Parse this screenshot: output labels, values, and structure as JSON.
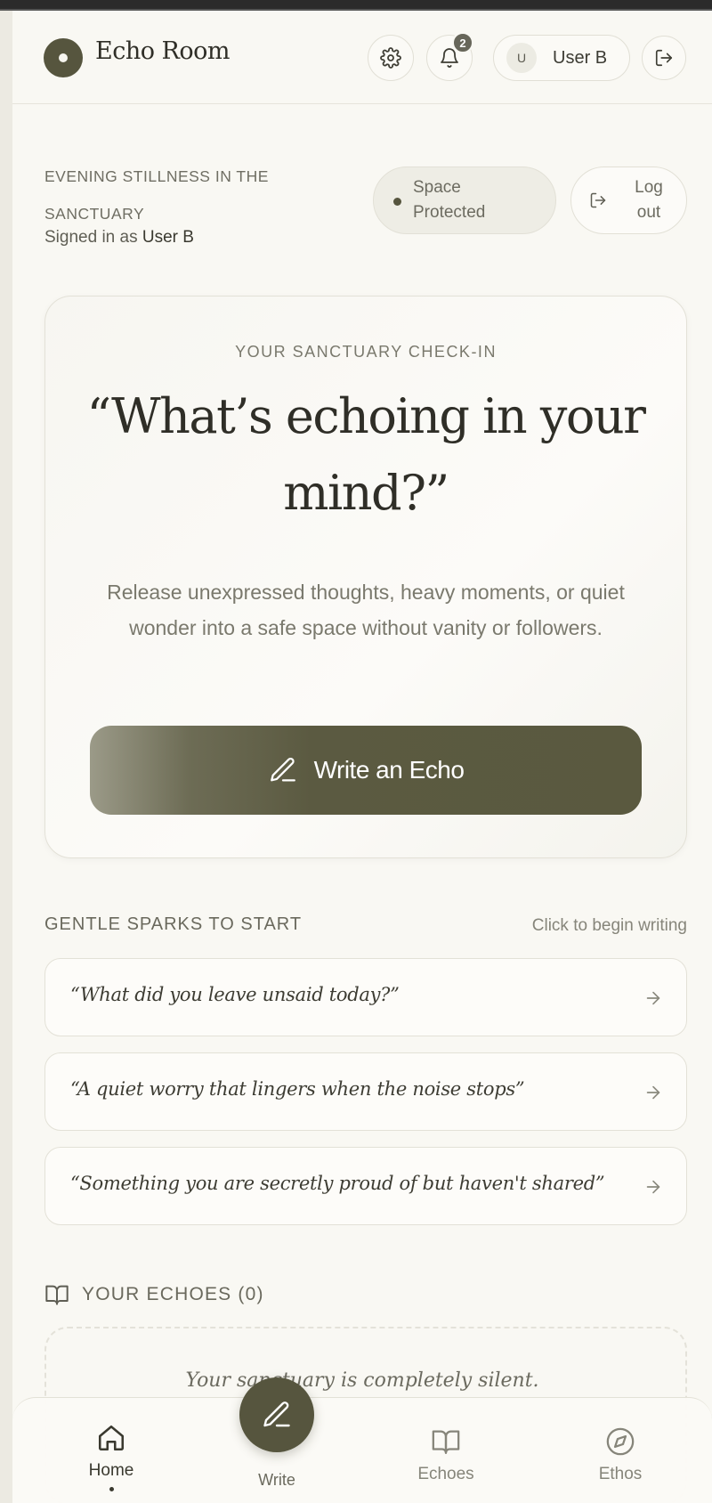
{
  "header": {
    "app_title": "Echo Room",
    "notification_count": "2",
    "user_initial": "U",
    "user_name": "User B",
    "icons": [
      "settings-icon",
      "bell-icon",
      "logout-icon"
    ]
  },
  "status": {
    "eyebrow": "EVENING STILLNESS IN THE SANCTUARY",
    "signed_in_prefix": "Signed in as ",
    "signed_in_user": "User B",
    "protected_label": "Space Protected",
    "logout_label": "Log out"
  },
  "checkin": {
    "eyebrow": "YOUR SANCTUARY CHECK-IN",
    "quote": "“What’s echoing in your mind?”",
    "description": "Release unexpressed thoughts, heavy moments, or quiet wonder into a safe space without vanity or followers.",
    "button_label": "Write an Echo"
  },
  "sparks": {
    "title": "GENTLE SPARKS TO START",
    "hint": "Click to begin writing",
    "items": [
      "“What did you leave unsaid today?”",
      "“A quiet worry that lingers when the noise stops”",
      "“Something you are secretly proud of but haven't shared”"
    ]
  },
  "echoes": {
    "title": "YOUR ECHOES (0)",
    "empty_text": "Your sanctuary is completely silent."
  },
  "nav": {
    "items": [
      {
        "label": "Home",
        "icon": "home-icon",
        "active": true
      },
      {
        "label": "Write",
        "icon": "pen-icon",
        "active": false
      },
      {
        "label": "Echoes",
        "icon": "book-icon",
        "active": false
      },
      {
        "label": "Ethos",
        "icon": "compass-icon",
        "active": false
      }
    ]
  },
  "colors": {
    "accent": "#56553e",
    "background": "#f9f8f3",
    "text": "#3f3e35"
  }
}
